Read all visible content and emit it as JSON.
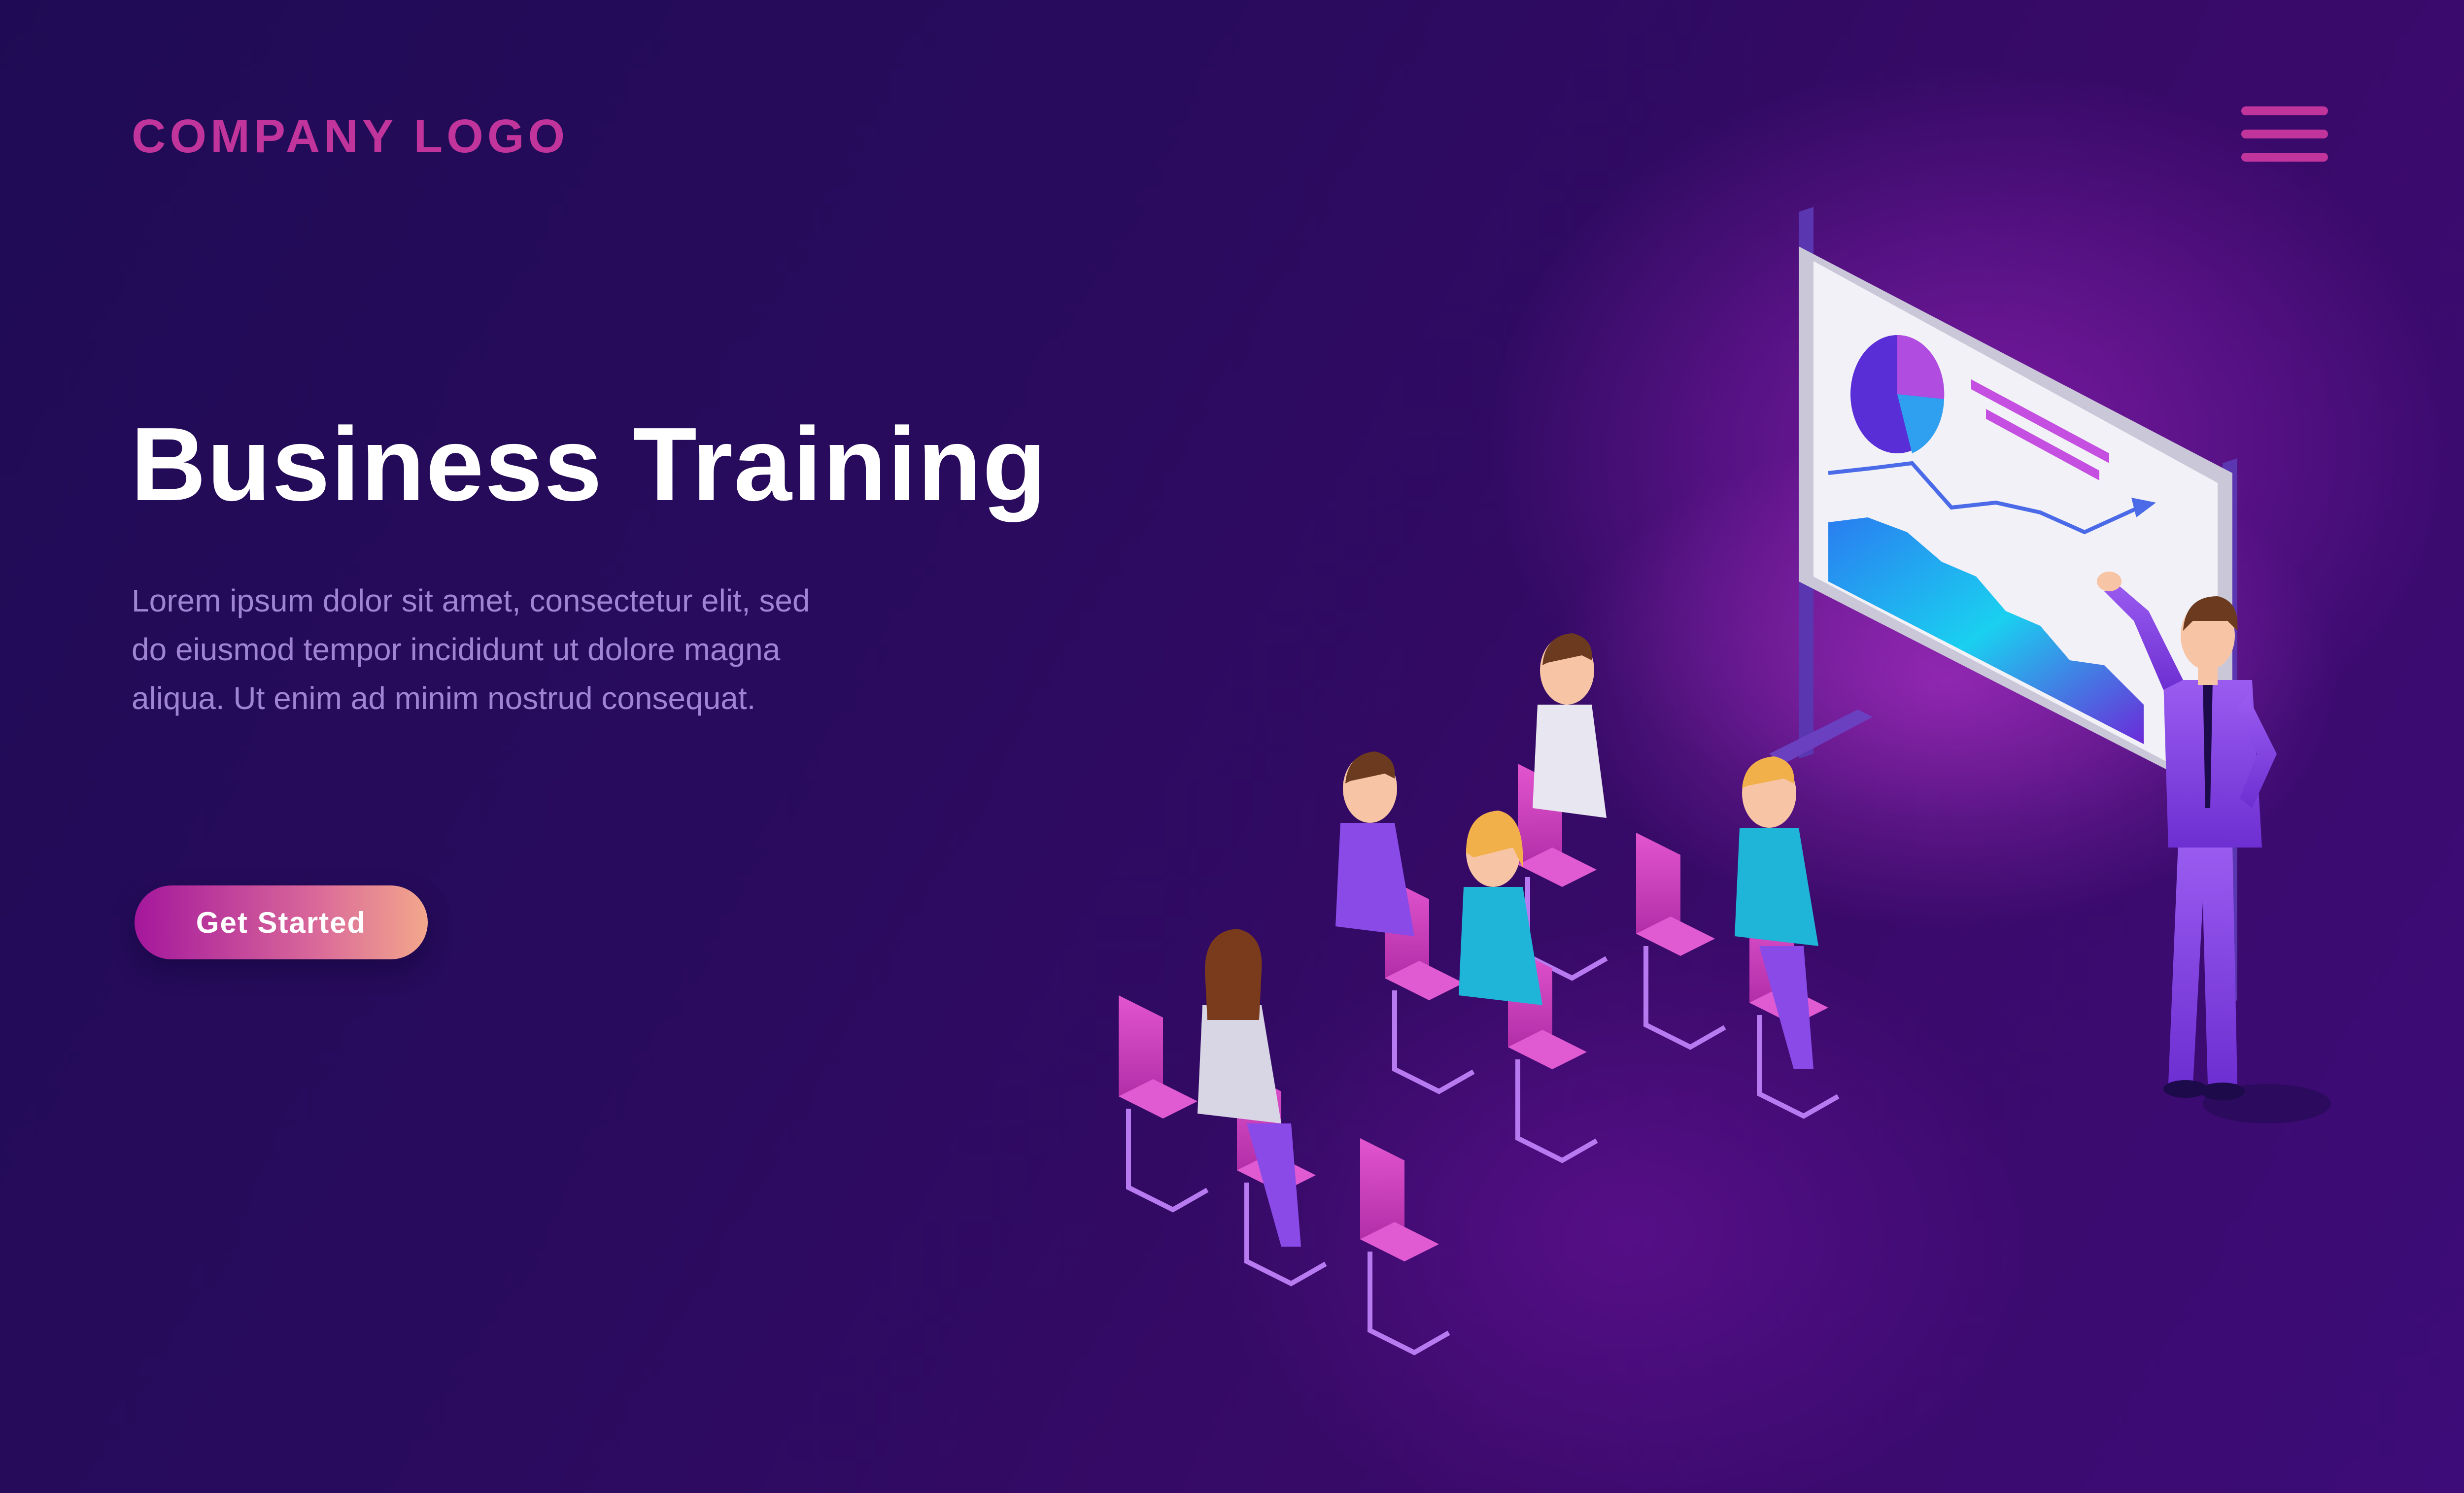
{
  "header": {
    "logo_text": "COMPANY LOGO",
    "menu_icon": "hamburger-menu-icon"
  },
  "hero": {
    "title": "Business Training",
    "description": "Lorem ipsum dolor sit amet, consectetur elit, sed do eiusmod tempor incididunt ut dolore magna aliqua. Ut enim ad minim nostrud consequat.",
    "cta_label": "Get Started"
  },
  "illustration": {
    "subject": "business-training-presentation-illustration"
  },
  "colors": {
    "background_dark": "#1f0b55",
    "background_accent": "#b028d2",
    "brand_magenta": "#c0349c",
    "title_text": "#ffffff",
    "body_text": "#a084d4",
    "button_gradient_start": "#a4179c",
    "button_gradient_end": "#f3a78c",
    "chair": "#d23fc4",
    "board_chart_blue": "#1ad0f0"
  }
}
